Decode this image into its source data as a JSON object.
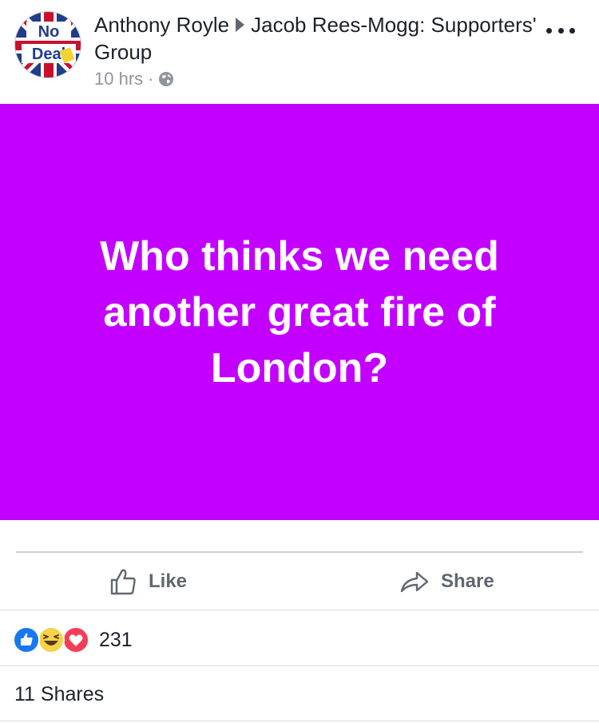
{
  "post": {
    "author": "Anthony Royle",
    "group": "Jacob Rees-Mogg: Supporters' Group",
    "time": "10 hrs",
    "separator": "·",
    "privacy_icon": "globe-icon",
    "avatar_text_top": "No",
    "avatar_text_bottom": "Deal",
    "text": "Who thinks we need another great fire of London?",
    "background_color": "#c300ff"
  },
  "actions": {
    "like_label": "Like",
    "share_label": "Share"
  },
  "stats": {
    "reaction_types": [
      "like",
      "haha",
      "love"
    ],
    "reaction_count": "231",
    "shares_text": "11 Shares"
  },
  "colors": {
    "accent": "#c300ff",
    "like_blue": "#1877f2",
    "love_red": "#f33e58",
    "haha_yellow": "#f7d24b"
  }
}
